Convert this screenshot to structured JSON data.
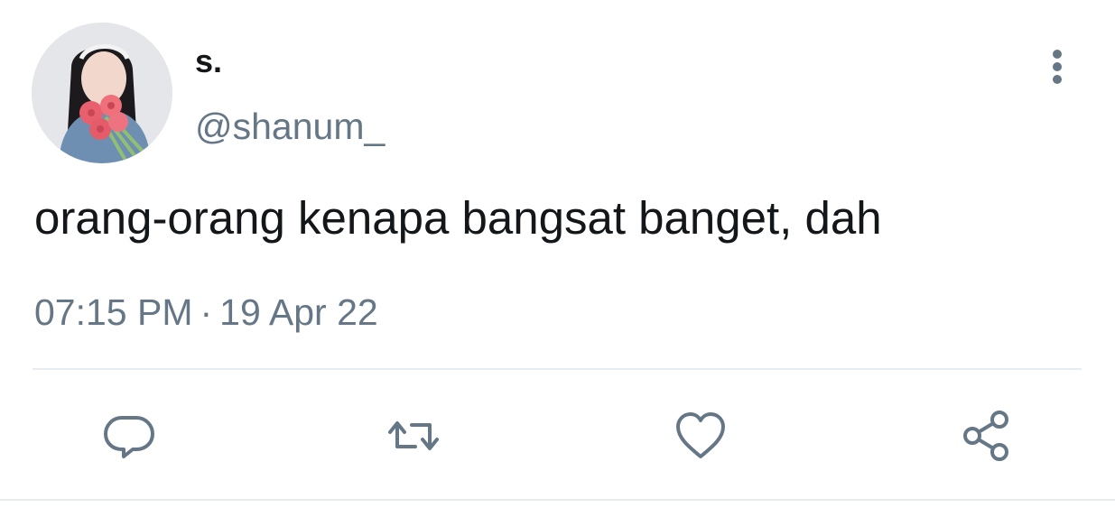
{
  "tweet": {
    "display_name": "s.",
    "handle": "@shanum_",
    "text": "orang-orang kenapa bangsat banget, dah",
    "time": "07:15 PM",
    "separator": "·",
    "date": "19 Apr 22"
  },
  "icons": {
    "avatar": "profile-photo",
    "more": "more-vertical-icon",
    "reply": "reply-icon",
    "retweet": "retweet-icon",
    "like": "heart-icon",
    "share": "share-icon"
  },
  "colors": {
    "text": "#14171a",
    "secondary": "#657786",
    "divider": "#e6ecf0"
  }
}
